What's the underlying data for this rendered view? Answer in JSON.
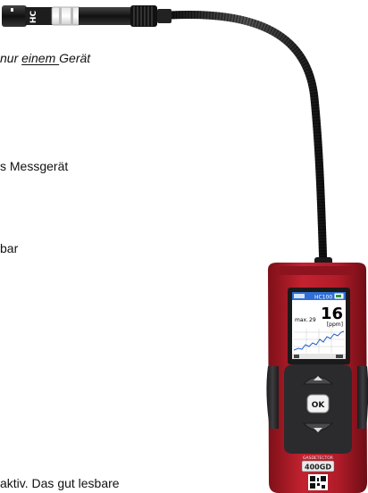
{
  "text_fragments": {
    "line1_prefix": "nur ",
    "line1_emph": "einem ",
    "line1_suffix": " Gerät",
    "line2": "s Messgerät",
    "line3": "bar",
    "line4": "aktiv. Das gut lesbare"
  },
  "device": {
    "probe_label": "HC",
    "screen_label_left": "HC100",
    "screen_reading": "16",
    "screen_unit": "[ppm]",
    "screen_max_label": "max.",
    "screen_max_value": "29",
    "ok_label": "OK",
    "model_line1": "GASDETECTOR",
    "model_line2": "400GD",
    "colors": {
      "body_red": "#b21d2b",
      "body_dark": "#2b2b2e",
      "screen_bg": "#ffffff",
      "graph_line": "#1f5fc9"
    }
  }
}
